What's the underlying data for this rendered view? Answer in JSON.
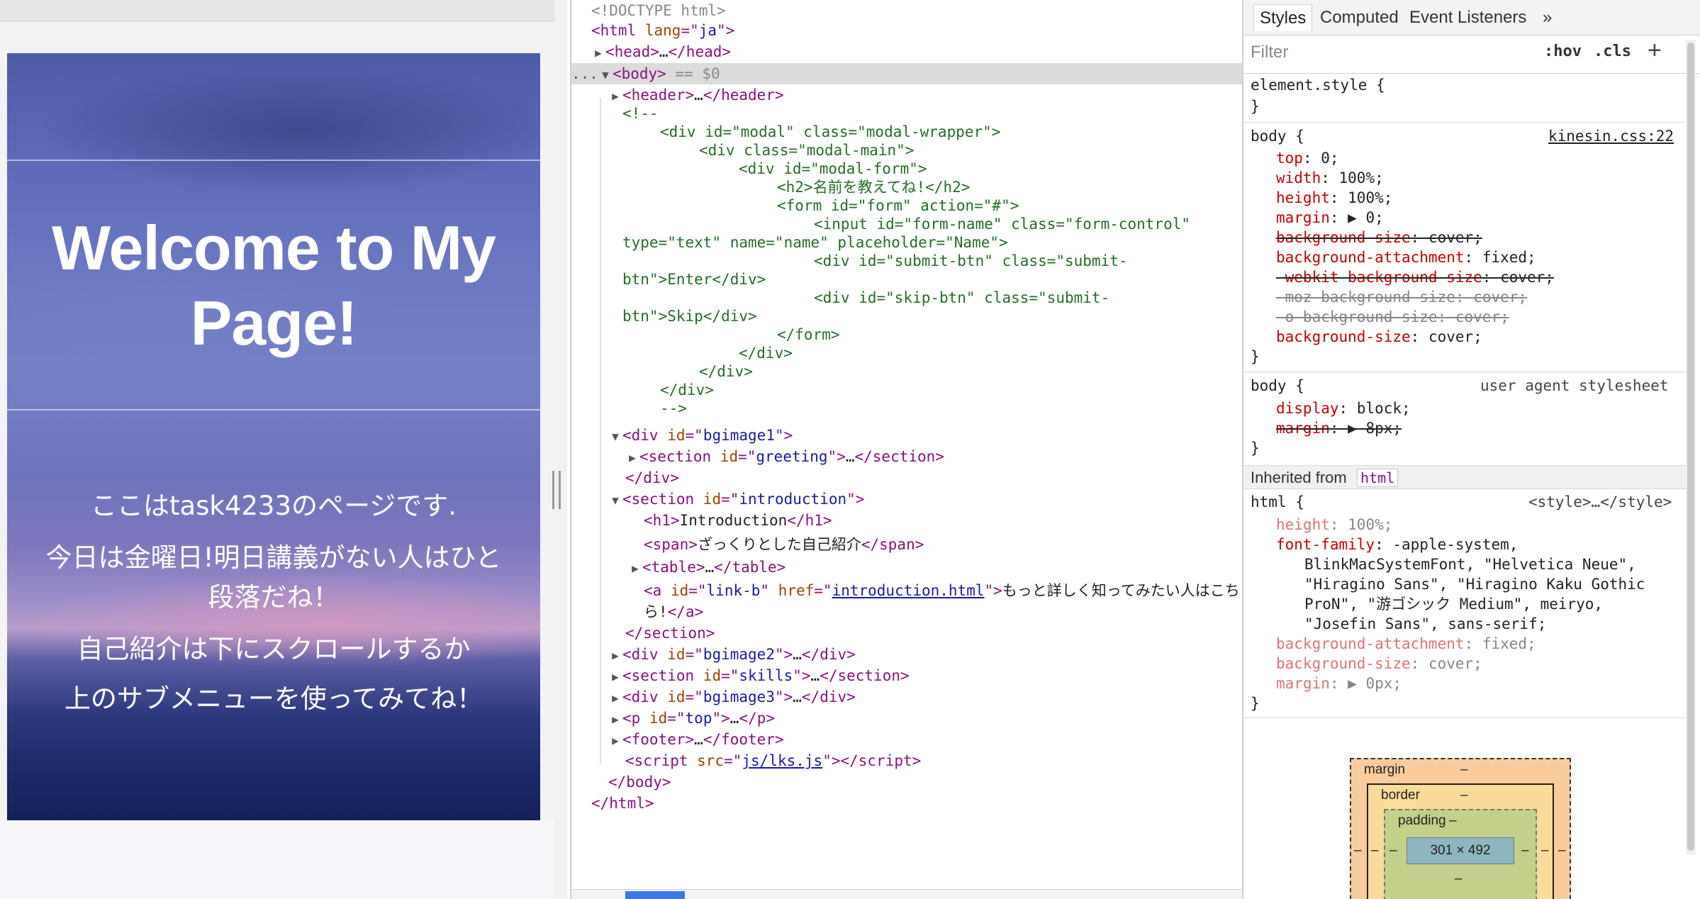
{
  "preview": {
    "hero_title": "Welcome to My Page!",
    "lines": [
      "ここはtask4233のページです.",
      "今日は金曜日!明日講義がない人はひと段落だね！",
      "自己紹介は下にスクロールするか",
      "上のサブメニューを使ってみてね！"
    ]
  },
  "elements": {
    "doctype": "<!DOCTYPE html>",
    "html_lang": "ja",
    "selected_marker": "== $0",
    "comment_lines": [
      "<!--",
      "<div id=\"modal\" class=\"modal-wrapper\">",
      "<div class=\"modal-main\">",
      "<div id=\"modal-form\">",
      "<h2>名前を教えてね!</h2>",
      "<form id=\"form\" action=\"#\">",
      "<input id=\"form-name\" class=\"form-control\"",
      "type=\"text\" name=\"name\" placeholder=\"Name\">",
      "<div id=\"submit-btn\" class=\"submit-",
      "btn\">Enter</div>",
      "<div id=\"skip-btn\" class=\"submit-",
      "btn\">Skip</div>",
      "</form>",
      "</div>",
      "</div>",
      "</div>",
      "-->"
    ],
    "bgimage1_id": "bgimage1",
    "greeting_id": "greeting",
    "introduction_id": "introduction",
    "h1_text": "Introduction",
    "span_text": "ざっくりとした自己紹介",
    "link_id": "link-b",
    "link_href": "introduction.html",
    "link_text_1": "もっと詳しく知ってみたい人はこち",
    "link_text_2": "ら!",
    "bgimage2_id": "bgimage2",
    "skills_id": "skills",
    "bgimage3_id": "bgimage3",
    "top_id": "top",
    "script_src": "js/lks.js"
  },
  "styles": {
    "tabs": [
      "Styles",
      "Computed",
      "Event Listeners"
    ],
    "overflow_icon": "»",
    "filter_placeholder": "Filter",
    "hov": ":hov",
    "cls": ".cls",
    "add_icon": "+",
    "element_style": "element.style {",
    "rule1": {
      "selector": "body {",
      "source": "kinesin.css:22",
      "props": [
        {
          "name": "top",
          "value": "0;",
          "strike": false
        },
        {
          "name": "width",
          "value": "100%;",
          "strike": false
        },
        {
          "name": "height",
          "value": "100%;",
          "strike": false
        },
        {
          "name": "margin",
          "value": "▶ 0;",
          "strike": false
        },
        {
          "name": "background-size",
          "value": "cover;",
          "strike": true
        },
        {
          "name": "background-attachment",
          "value": "fixed;",
          "strike": false
        },
        {
          "name": "-webkit-background-size",
          "value": "cover;",
          "strike": true
        },
        {
          "name": "-moz-background-size",
          "value": "cover;",
          "strike": true,
          "faded": true
        },
        {
          "name": "-o-background-size",
          "value": "cover;",
          "strike": true,
          "faded": true
        },
        {
          "name": "background-size",
          "value": "cover;",
          "strike": false
        }
      ]
    },
    "rule2": {
      "selector": "body {",
      "source": "user agent stylesheet",
      "props": [
        {
          "name": "display",
          "value": "block;",
          "strike": false
        },
        {
          "name": "margin",
          "value": "▶ 8px;",
          "strike": true
        }
      ]
    },
    "inherited_label": "Inherited from",
    "inherited_tag": "html",
    "rule3": {
      "selector": "html {",
      "source": "<style>…</style>",
      "height": "100%;",
      "font_family_lines": [
        "-apple-system,",
        "BlinkMacSystemFont, \"Helvetica Neue\",",
        "\"Hiragino Sans\", \"Hiragino Kaku Gothic",
        "ProN\", \"游ゴシック Medium\", meiryo,",
        "\"Josefin Sans\", sans-serif;"
      ],
      "bg_attachment": "fixed;",
      "bg_size": "cover;",
      "margin": "▶ 0px;"
    },
    "box_model": {
      "margin_label": "margin",
      "border_label": "border",
      "padding_label": "padding",
      "dash": "–",
      "content_size": "301 × 492"
    }
  }
}
